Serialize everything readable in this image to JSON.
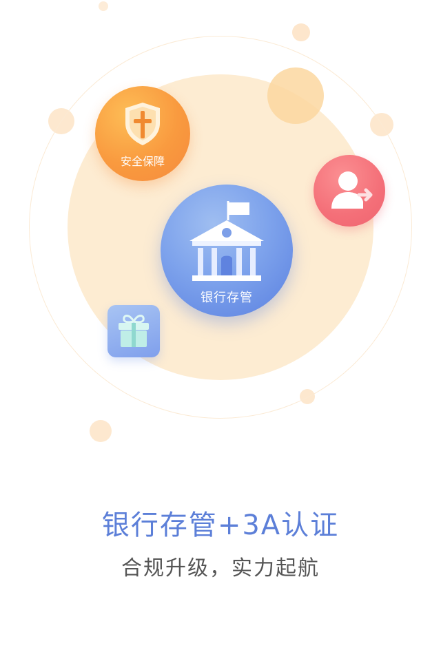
{
  "illustration": {
    "center_label": "银行存管",
    "shield_label": "安全保障",
    "icons": {
      "center": "bank-icon",
      "shield": "shield-icon",
      "user": "user-transfer-icon",
      "gift": "gift-icon"
    }
  },
  "text": {
    "headline": "银行存管+3A认证",
    "subline": "合规升级，实力起航"
  },
  "colors": {
    "headline": "#5c7fd8",
    "subline": "#555555",
    "shield_orange": "#f99a3f",
    "center_blue": "#6f93e8",
    "user_pink": "#f46f78",
    "glow_peach": "#fdecd2"
  }
}
